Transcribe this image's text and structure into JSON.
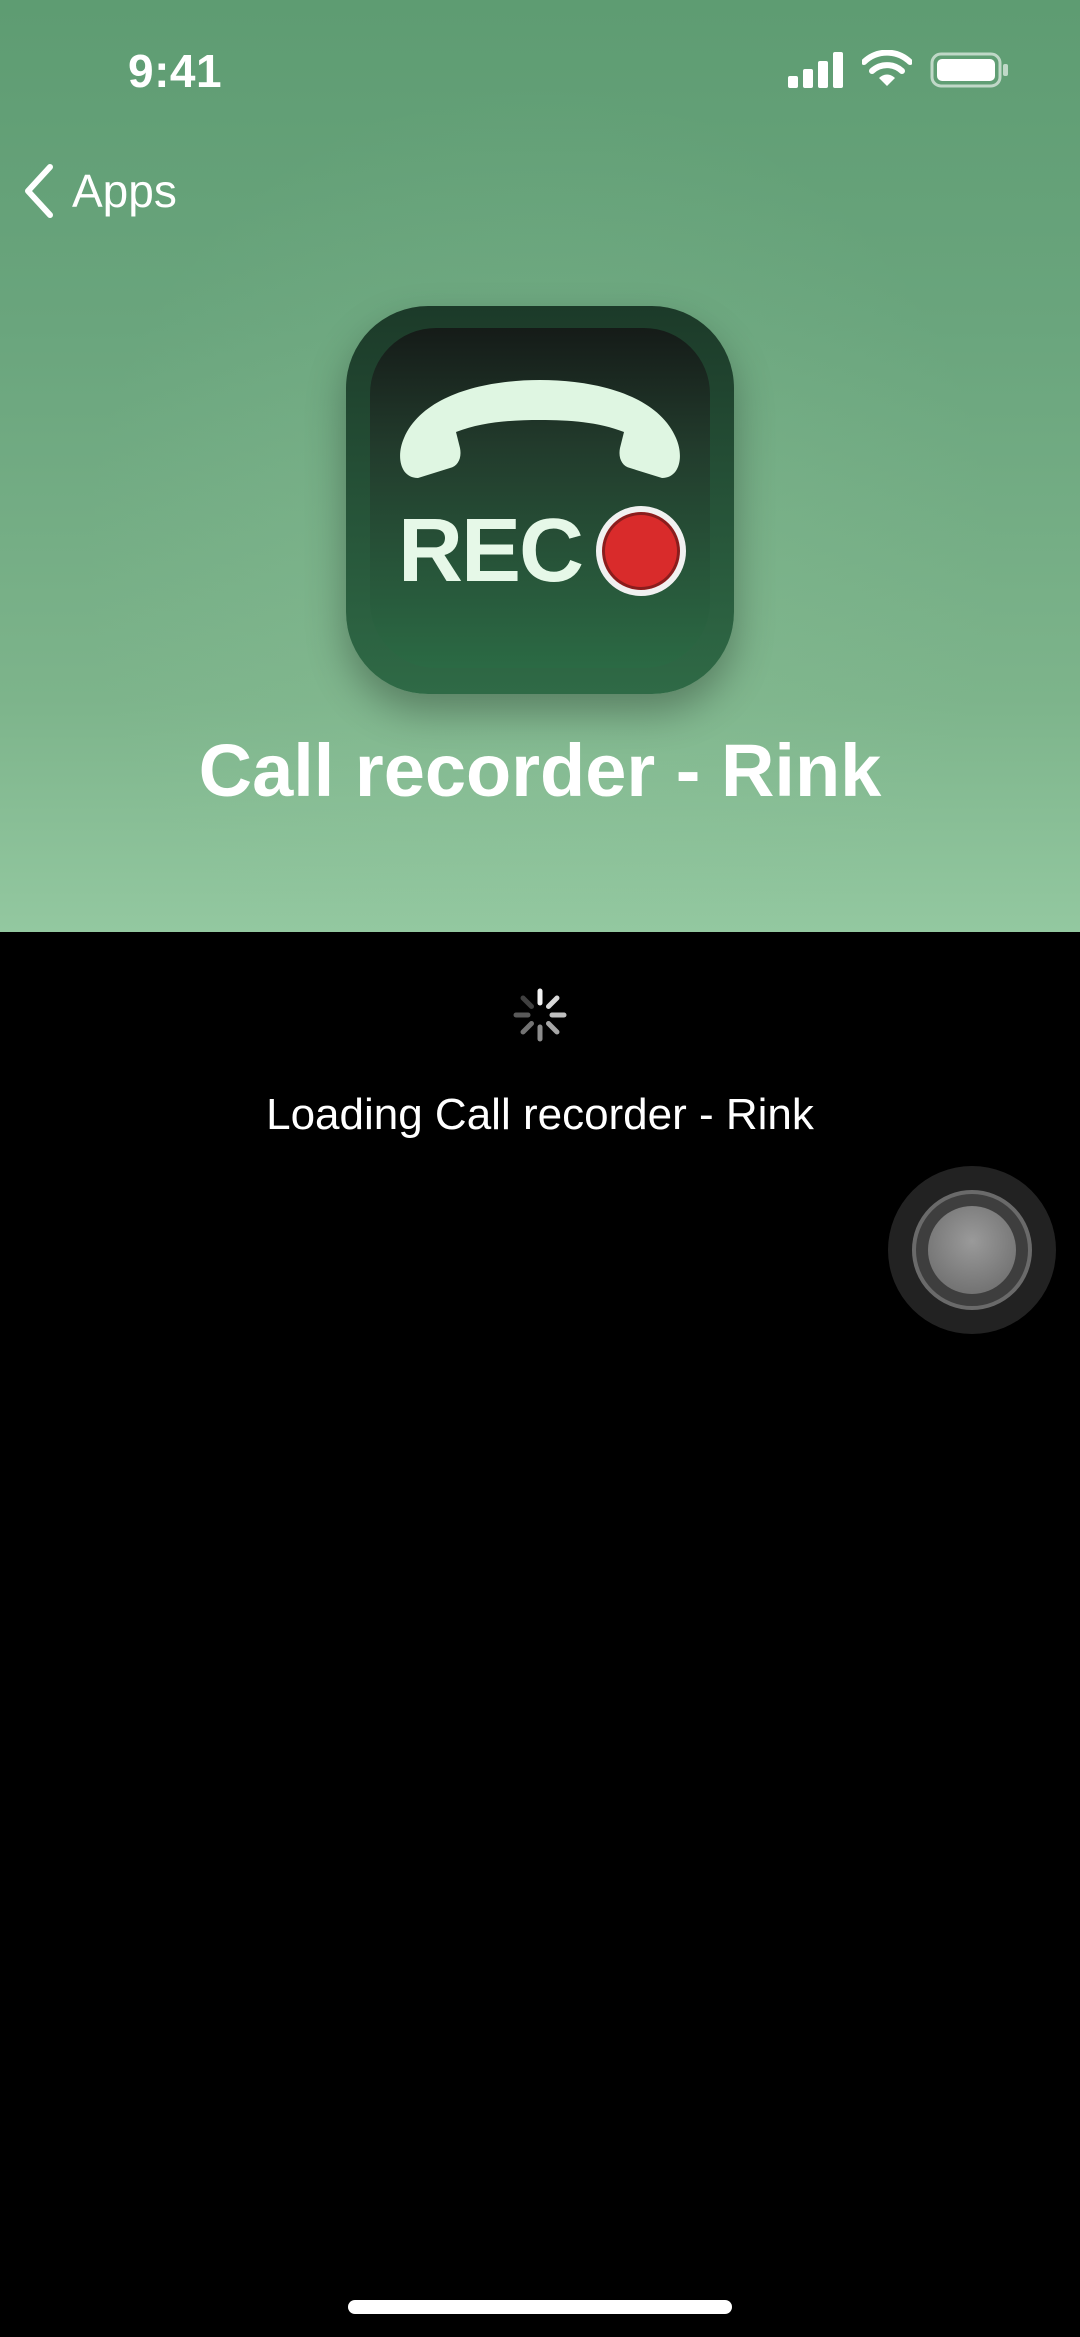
{
  "status_bar": {
    "time": "9:41"
  },
  "nav": {
    "back_label": "Apps"
  },
  "app": {
    "icon_text": "REC",
    "title": "Call recorder - Rink"
  },
  "loading": {
    "text": "Loading Call recorder - Rink"
  },
  "colors": {
    "header_green": "#6aa57d",
    "record_red": "#d92b2b",
    "background": "#000000"
  },
  "icons": {
    "status": [
      "signal-icon",
      "wifi-icon",
      "battery-icon"
    ],
    "back": "chevron-left-icon",
    "app": "phone-handset-icon",
    "loading": "spinner-icon"
  }
}
